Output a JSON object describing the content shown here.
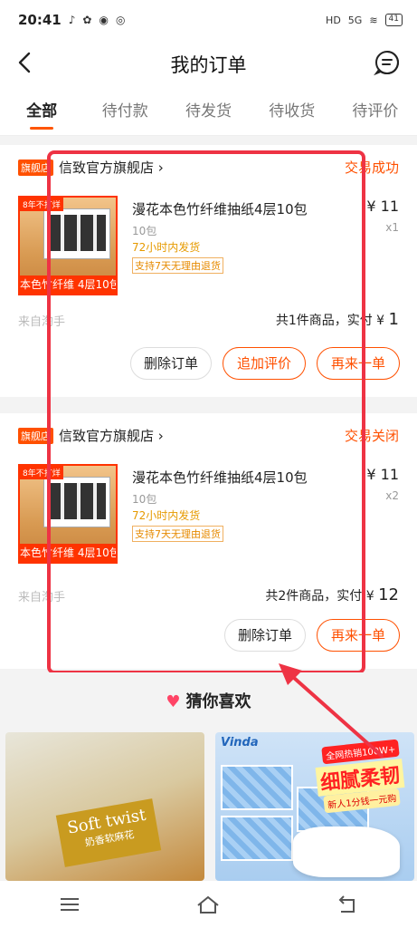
{
  "status_bar": {
    "time": "20:41",
    "app_icons": [
      "tiktok-icon",
      "flower-icon",
      "weibo-icon",
      "weibo-icon"
    ],
    "right_text": "5G",
    "battery": "41"
  },
  "header": {
    "title": "我的订单"
  },
  "tabs": [
    {
      "label": "全部",
      "active": true
    },
    {
      "label": "待付款",
      "active": false
    },
    {
      "label": "待发货",
      "active": false
    },
    {
      "label": "待收货",
      "active": false
    },
    {
      "label": "待评价",
      "active": false
    }
  ],
  "orders": [
    {
      "shop_badge": "旗舰店",
      "shop_name": "信致官方旗舰店",
      "status": "交易成功",
      "product_name": "漫花本色竹纤维抽纸4层10包",
      "spec": "10包",
      "shipping": "72小时内发货",
      "return_policy": "支持7天无理由退货",
      "thumb_tag": "8年不打烊",
      "thumb_caption": "本色竹纤维 4层10包",
      "price": "¥ 11",
      "quantity": "x1",
      "source": "来自淘手",
      "summary_prefix": "共1件商品，实付 ¥",
      "total": "1",
      "buttons": [
        "删除订单",
        "追加评价",
        "再来一单"
      ]
    },
    {
      "shop_badge": "旗舰店",
      "shop_name": "信致官方旗舰店",
      "status": "交易关闭",
      "product_name": "漫花本色竹纤维抽纸4层10包",
      "spec": "10包",
      "shipping": "72小时内发货",
      "return_policy": "支持7天无理由退货",
      "thumb_tag": "8年不打烊",
      "thumb_caption": "本色竹纤维 4层10包",
      "price": "¥ 11",
      "quantity": "x2",
      "source": "来自淘手",
      "summary_prefix": "共2件商品，实付 ¥",
      "total": "12",
      "buttons": [
        "删除订单",
        "再来一单"
      ]
    }
  ],
  "recommend": {
    "title": "猜你喜欢",
    "left_label_main": "Soft twist",
    "left_label_sub": "奶香软麻花",
    "right_brand": "Vinda",
    "right_promo": "全网热销100W+",
    "right_big": "细腻柔韧",
    "right_sub": "新人1分钱一元购"
  },
  "colors": {
    "accent": "#ff5000",
    "highlight": "#ee3344"
  }
}
